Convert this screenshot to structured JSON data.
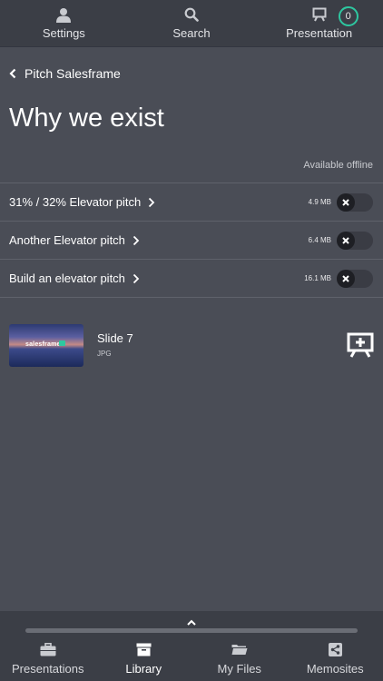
{
  "top_nav": {
    "settings_label": "Settings",
    "search_label": "Search",
    "presentation_label": "Presentation",
    "presentation_count": "0",
    "badge_color": "#2ec7a0"
  },
  "breadcrumb": {
    "label": "Pitch Salesframe"
  },
  "page_title": "Why we exist",
  "offline_label": "Available offline",
  "pitches": [
    {
      "name": "31% / 32% Elevator pitch",
      "size": "4.9 MB"
    },
    {
      "name": "Another Elevator pitch",
      "size": "6.4 MB"
    },
    {
      "name": "Build an elevator pitch",
      "size": "16.1 MB"
    }
  ],
  "slide": {
    "title": "Slide 7",
    "type": "JPG",
    "thumbnail_text": "salesframe"
  },
  "bottom_tabs": [
    {
      "label": "Presentations",
      "icon": "briefcase-icon"
    },
    {
      "label": "Library",
      "icon": "archive-icon",
      "active": true
    },
    {
      "label": "My Files",
      "icon": "folder-icon"
    },
    {
      "label": "Memosites",
      "icon": "share-icon"
    }
  ]
}
